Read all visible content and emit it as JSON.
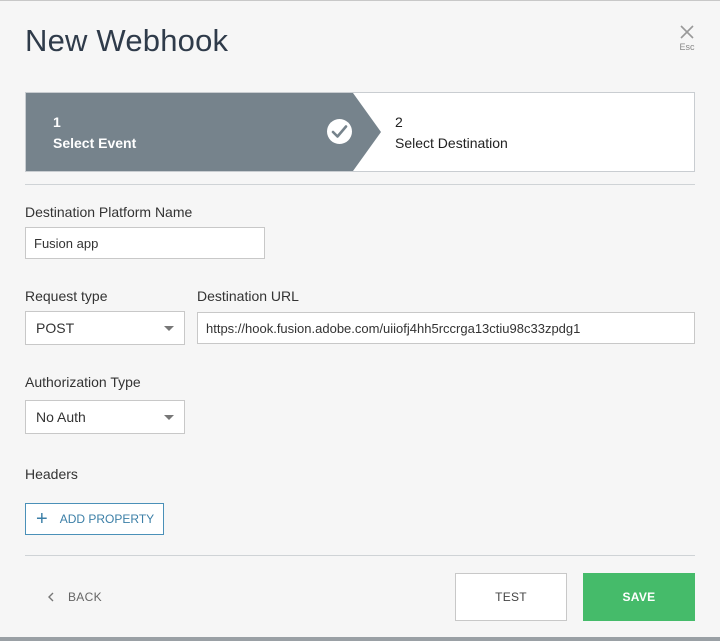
{
  "dialog": {
    "title": "New Webhook",
    "close_hint": "Esc"
  },
  "stepper": {
    "steps": [
      {
        "number": "1",
        "label": "Select Event",
        "state": "completed"
      },
      {
        "number": "2",
        "label": "Select Destination",
        "state": "current"
      }
    ]
  },
  "form": {
    "platform_name": {
      "label": "Destination Platform Name",
      "value": "Fusion app"
    },
    "request_type": {
      "label": "Request type",
      "value": "POST"
    },
    "destination_url": {
      "label": "Destination URL",
      "value": "https://hook.fusion.adobe.com/uiiofj4hh5rccrga13ctiu98c33zpdg1"
    },
    "authorization_type": {
      "label": "Authorization Type",
      "value": "No Auth"
    },
    "headers": {
      "label": "Headers",
      "add_label": "ADD PROPERTY"
    }
  },
  "footer": {
    "back_label": "BACK",
    "test_label": "TEST",
    "save_label": "SAVE"
  },
  "colors": {
    "step_completed_bg": "#76838c",
    "save_green": "#45bb6a",
    "link_blue": "#3c7fa7"
  }
}
